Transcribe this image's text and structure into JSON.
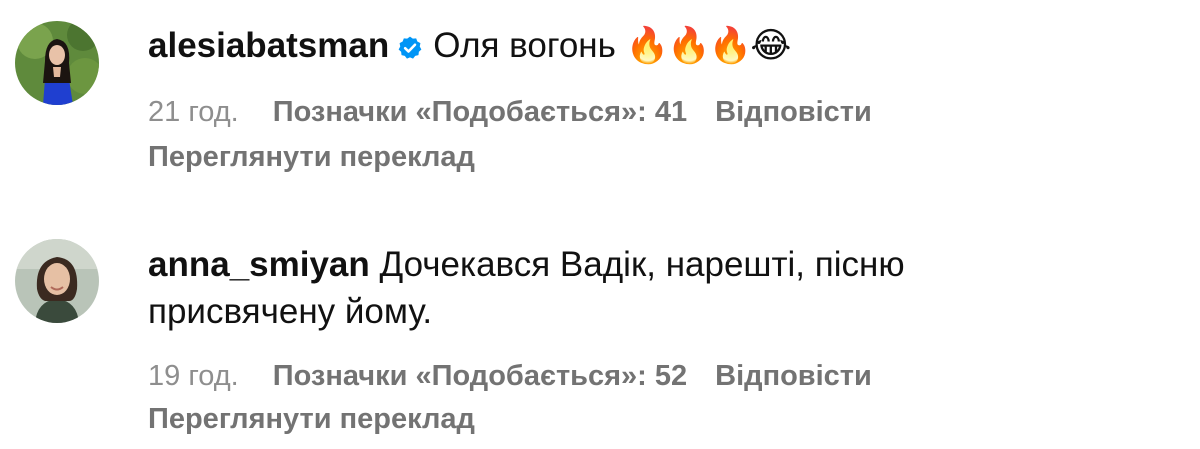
{
  "comments": [
    {
      "username": "alesiabatsman",
      "verified": true,
      "text": "Оля вогонь ",
      "emojis": "🔥🔥🔥😂",
      "time": "21 год.",
      "likes": "Позначки «Подобається»: 41",
      "reply": "Відповісти",
      "translate": "Переглянути переклад"
    },
    {
      "username": "anna_smiyan",
      "verified": false,
      "text": "Дочекався Вадік, нарешті, пісню присвячену йому.",
      "time": "19 год.",
      "likes": "Позначки «Подобається»: 52",
      "reply": "Відповісти",
      "translate": "Переглянути переклад"
    }
  ],
  "colors": {
    "verified_badge": "#0095f6",
    "meta_text": "#737373",
    "primary_text": "#111111"
  },
  "icons": {
    "verified": "verified-badge-icon"
  }
}
